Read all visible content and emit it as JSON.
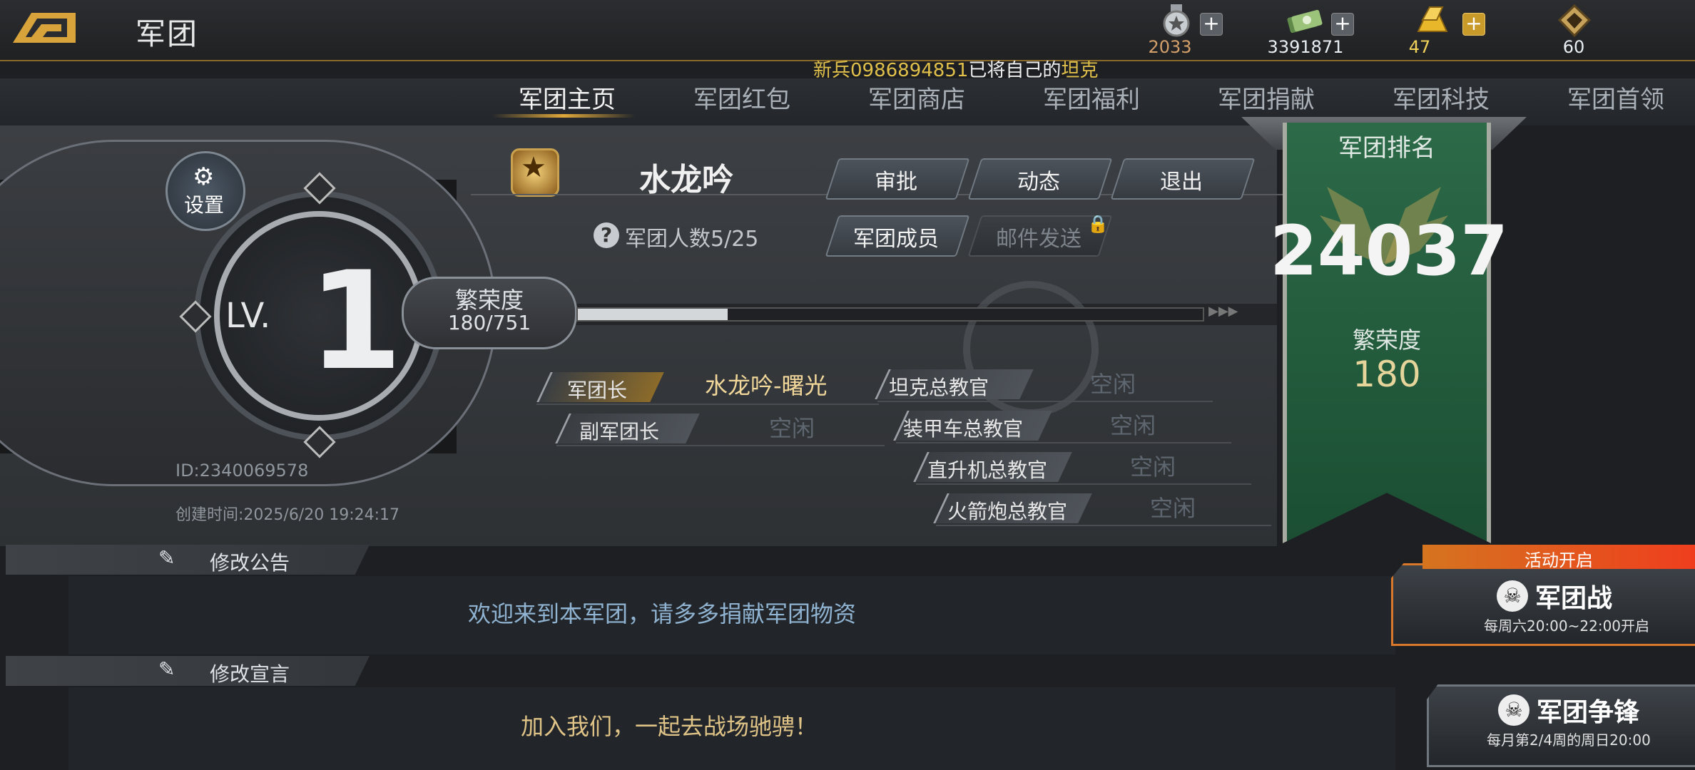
{
  "header": {
    "title": "军团",
    "resources": [
      {
        "name": "medal",
        "value": "2033",
        "color": "#d4a06a",
        "has_plus": true
      },
      {
        "name": "cash",
        "value": "3391871",
        "color": "#e8eef2",
        "has_plus": true
      },
      {
        "name": "gold",
        "value": "47",
        "color": "#f2d35a",
        "has_plus": true
      },
      {
        "name": "crystal",
        "value": "60",
        "color": "#e8eef2",
        "has_plus": false
      }
    ],
    "ticker": {
      "prefix": "新兵0986894851",
      "middle": "已将自己的",
      "suffix": "坦克"
    }
  },
  "tabs": [
    {
      "label": "军团主页",
      "active": true
    },
    {
      "label": "军团红包",
      "active": false
    },
    {
      "label": "军团商店",
      "active": false
    },
    {
      "label": "军团福利",
      "active": false
    },
    {
      "label": "军团捐献",
      "active": false
    },
    {
      "label": "军团科技",
      "active": false
    },
    {
      "label": "军团首领",
      "active": false
    }
  ],
  "legion": {
    "level_label": "LV.",
    "level": "1",
    "settings_label": "设置",
    "id": "ID:2340069578",
    "created": "创建时间:2025/6/20 19:24:17",
    "name": "水龙吟",
    "members": "军团人数5/25",
    "prosperity_label": "繁荣度",
    "prosperity_value": "180/751",
    "prosperity_fraction": 0.24
  },
  "actions": {
    "approve": "审批",
    "activity": "动态",
    "quit": "退出",
    "members": "军团成员",
    "mail": "邮件发送"
  },
  "roles": [
    {
      "title": "军团长",
      "holder": "水龙吟-曙光"
    },
    {
      "title": "副军团长",
      "holder": "空闲"
    },
    {
      "title": "坦克总教官",
      "holder": "空闲"
    },
    {
      "title": "装甲车总教官",
      "holder": "空闲"
    },
    {
      "title": "直升机总教官",
      "holder": "空闲"
    },
    {
      "title": "火箭炮总教官",
      "holder": "空闲"
    }
  ],
  "ranking": {
    "title": "军团排名",
    "rank": "24037",
    "prosperity_label": "繁荣度",
    "prosperity": "180"
  },
  "notice": {
    "edit_label": "修改公告",
    "text": "欢迎来到本军团，请多多捐献军团物资"
  },
  "declaration": {
    "edit_label": "修改宣言",
    "text": "加入我们，一起去战场驰骋！"
  },
  "events": [
    {
      "badge": "活动开启",
      "title": "军团战",
      "schedule": "每周六20:00~22:00开启"
    },
    {
      "title": "军团争锋",
      "schedule": "每月第2/4周的周日20:00"
    }
  ],
  "colors": {
    "accent_gold": "#e0a83a",
    "banner_green": "#2c6a48",
    "event_orange": "#d9782a"
  }
}
